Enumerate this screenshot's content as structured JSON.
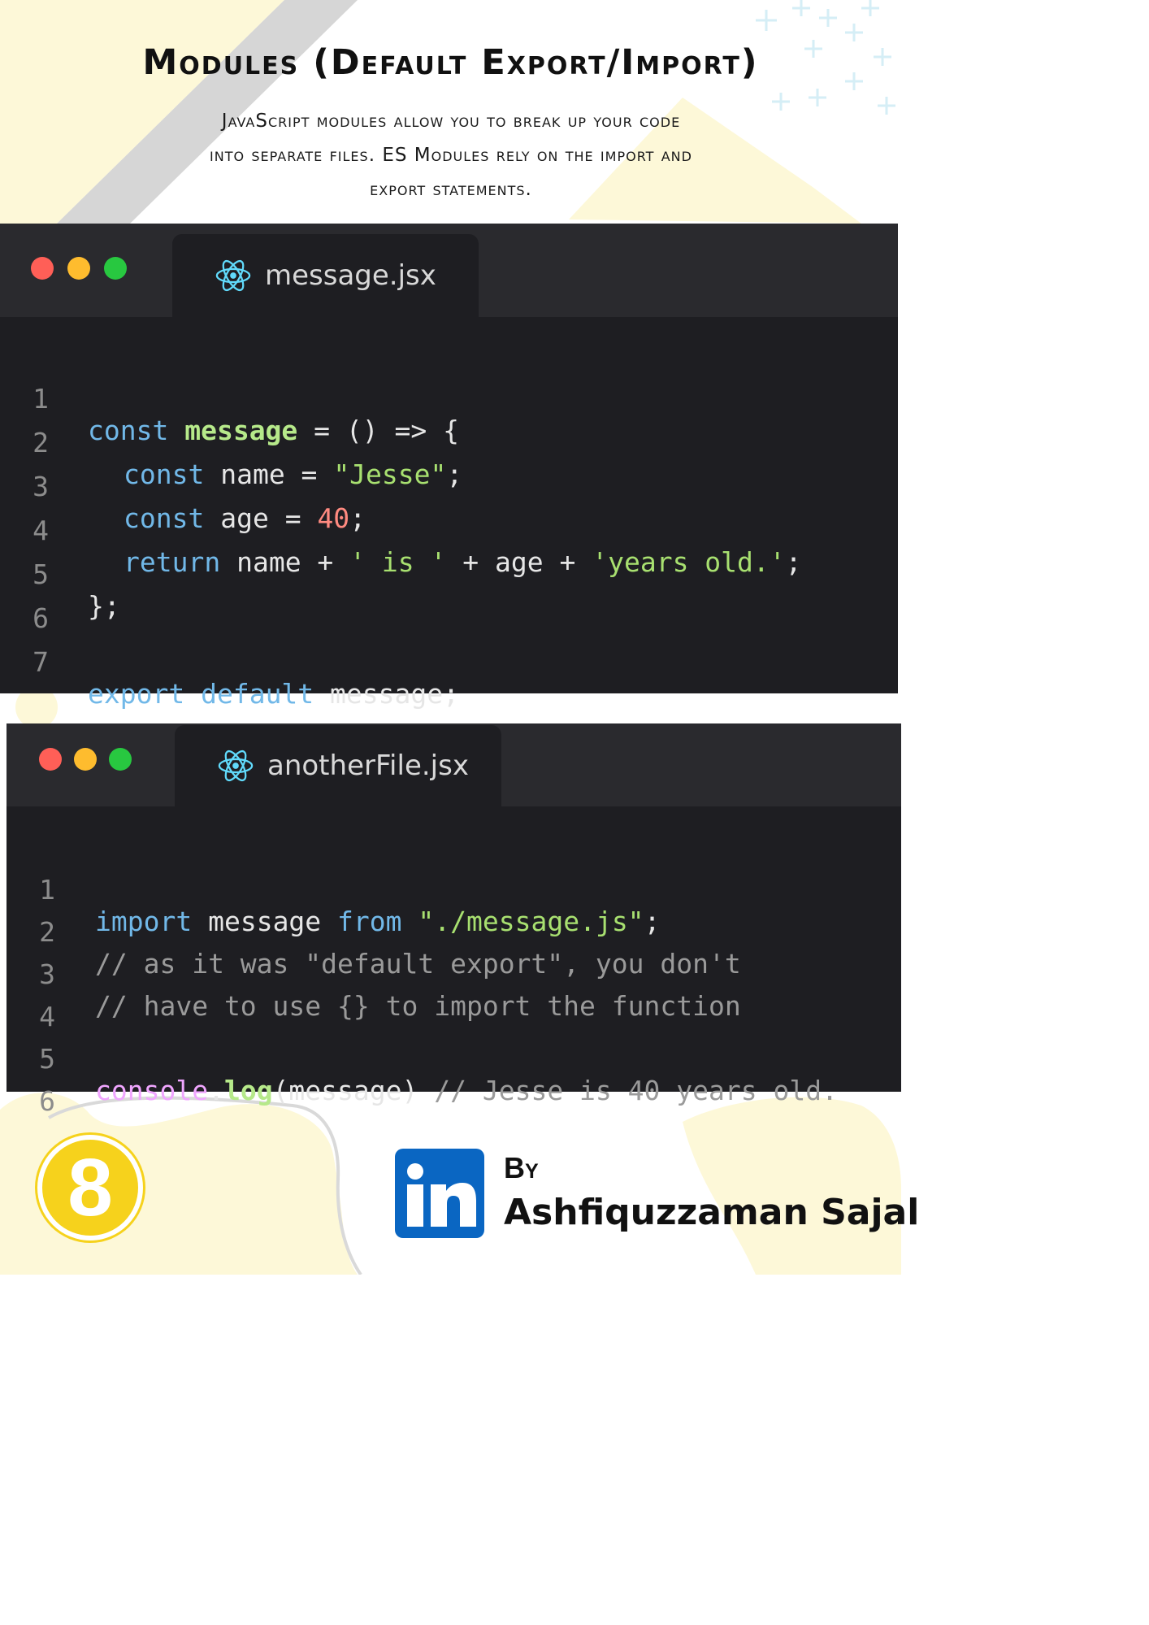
{
  "header": {
    "title": "Modules (Default Export/Import)",
    "description_lines": [
      "JavaScript modules allow you to break up your code",
      "into separate files. ES Modules rely on the import and",
      "export statements."
    ]
  },
  "editors": [
    {
      "tab_label": "message.jsx",
      "line_numbers": [
        "1",
        "2",
        "3",
        "4",
        "5",
        "6",
        "7"
      ],
      "code": {
        "l1": [
          "const",
          "message",
          "= () => {"
        ],
        "l2": [
          "const",
          "name =",
          "\"Jesse\"",
          ";"
        ],
        "l3": [
          "const",
          "age =",
          "40",
          ";"
        ],
        "l4": [
          "return",
          "name +",
          "' is '",
          "+ age +",
          "'years old.'",
          ";"
        ],
        "l5": [
          "};"
        ],
        "l7": [
          "export",
          "default",
          "message;"
        ]
      }
    },
    {
      "tab_label": "anotherFile.jsx",
      "line_numbers": [
        "1",
        "2",
        "3",
        "4",
        "5",
        "6"
      ],
      "code": {
        "l1": [
          "import",
          "message",
          "from",
          "\"./message.js\"",
          ";"
        ],
        "l2": [
          "// as it was \"default export\", you don't"
        ],
        "l3": [
          "// have to use {} to import the function"
        ],
        "l5": [
          "console",
          ".",
          "log",
          "(message)",
          "// Jesse is 40 years old."
        ]
      }
    }
  ],
  "footer": {
    "badge_number": "8",
    "by_label": "By",
    "author_name": "Ashfiquzzaman Sajal",
    "logo_text": "in"
  },
  "colors": {
    "editor_bg": "#1e1e22",
    "titlebar_bg": "#2a2a2e",
    "dot_red": "#ff5f57",
    "dot_yellow": "#febc2e",
    "dot_green": "#28c840",
    "linkedin_blue": "#0a66c2",
    "badge_yellow": "#f6d21c"
  }
}
